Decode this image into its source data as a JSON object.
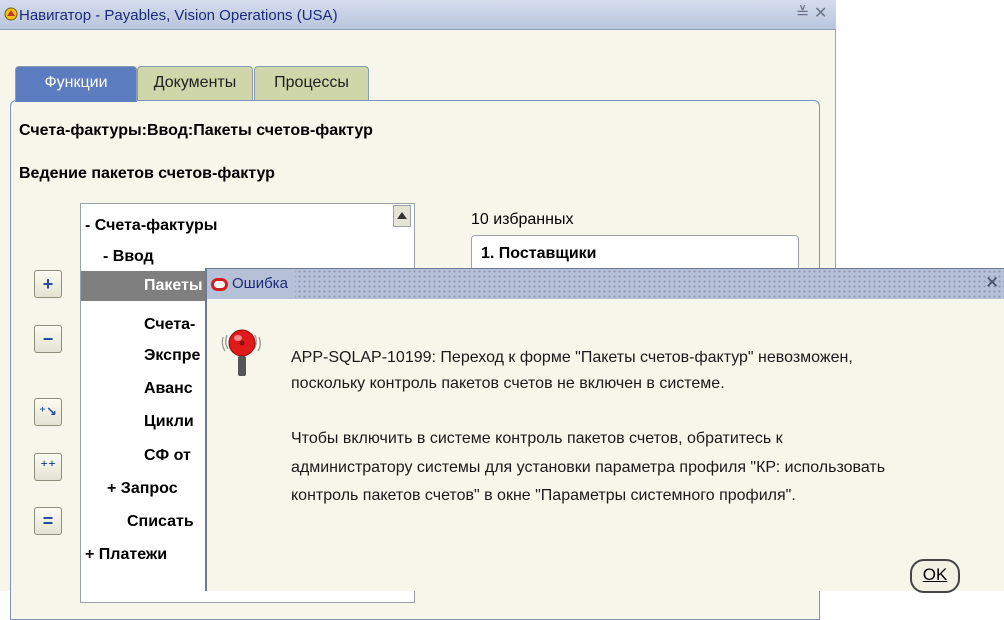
{
  "window": {
    "title": "Навигатор - Payables, Vision Operations (USA)",
    "minimize_glyph": "≚",
    "close_glyph": "✕"
  },
  "tabs": [
    {
      "label": "Функции",
      "active": true
    },
    {
      "label": "Документы",
      "active": false
    },
    {
      "label": "Процессы",
      "active": false
    }
  ],
  "breadcrumb": "Счета-фактуры:Ввод:Пакеты счетов-фактур",
  "function_description": "Ведение пакетов счетов-фактур",
  "side_buttons": [
    {
      "icon": "expand-icon",
      "glyph": "+"
    },
    {
      "icon": "collapse-icon",
      "glyph": "−"
    },
    {
      "icon": "expand-branch-icon",
      "glyph": "⁺↘"
    },
    {
      "icon": "expand-all-icon",
      "glyph": "⁺⁺"
    },
    {
      "icon": "collapse-all-icon",
      "glyph": "="
    }
  ],
  "tree": [
    {
      "label": "- Счета-фактуры"
    },
    {
      "label": "- Ввод"
    },
    {
      "label": "Пакеты",
      "selected": true
    },
    {
      "label": "Счета-"
    },
    {
      "label": "Экспре"
    },
    {
      "label": "Аванс"
    },
    {
      "label": "Цикли"
    },
    {
      "label": "СФ от"
    },
    {
      "label": "+ Запрос"
    },
    {
      "label": "Списать"
    },
    {
      "label": "+ Платежи"
    }
  ],
  "favorites": {
    "label": "10 избранных",
    "items": [
      "1. Поставщики"
    ]
  },
  "error_dialog": {
    "title": "Ошибка",
    "close_glyph": "✕",
    "message_lines": [
      "APP-SQLAP-10199: Переход к форме \"Пакеты счетов-фактур\" невозможен,",
      "поскольку контроль пакетов счетов не включен в системе.",
      "Чтобы включить в системе контроль пакетов счетов, обратитесь к",
      "администратору системы для установки параметра профиля \"КР: использовать",
      "контроль пакетов счетов\" в окне \"Параметры системного профиля\"."
    ],
    "ok_label": "OK",
    "colors": {
      "logo": "#d41f1f",
      "bell": "#e01a1a"
    }
  }
}
